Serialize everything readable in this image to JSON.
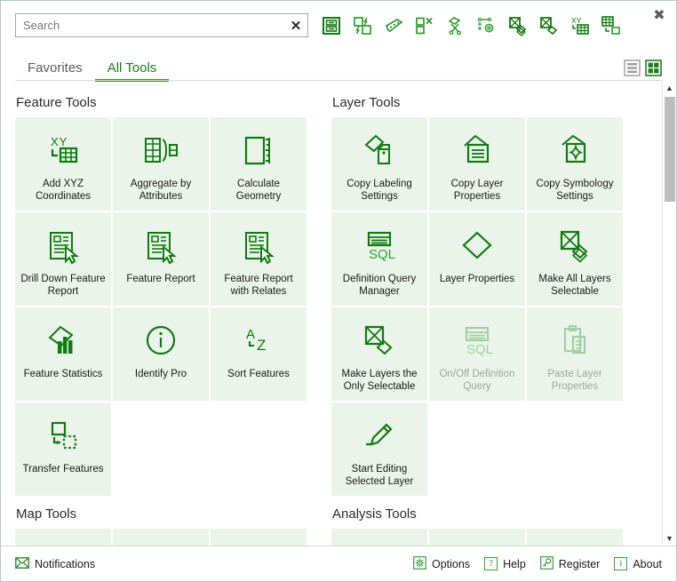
{
  "window": {
    "close_label": "✖"
  },
  "search": {
    "value": "",
    "placeholder": "Search",
    "clear_label": "✕"
  },
  "toolbar": {
    "icons": [
      {
        "name": "batch-attribute-editor-icon",
        "title": "Batch Attribute Editor"
      },
      {
        "name": "flip-fields-icon",
        "title": "Flip Fields"
      },
      {
        "name": "polygon-vertices-icon",
        "title": "Polygon Vertices"
      },
      {
        "name": "delete-feature-icon",
        "title": "Delete Feature"
      },
      {
        "name": "cut-polygons-icon",
        "title": "Cut Polygons"
      },
      {
        "name": "geoprocessing-settings-icon",
        "title": "Geoprocessing Settings"
      },
      {
        "name": "select-layers-stack-icon",
        "title": "Select Layers"
      },
      {
        "name": "select-layer-icon",
        "title": "Select Layer"
      },
      {
        "name": "xy-to-table-icon",
        "title": "XY To Table"
      },
      {
        "name": "table-to-feature-icon",
        "title": "Table To Feature"
      }
    ]
  },
  "tabs": [
    {
      "label": "Favorites",
      "active": false
    },
    {
      "label": "All Tools",
      "active": true
    }
  ],
  "view_toggles": [
    {
      "name": "list-view-toggle",
      "label": "List view",
      "active": false
    },
    {
      "name": "grid-view-toggle",
      "label": "Grid view",
      "active": true
    }
  ],
  "groups": [
    {
      "name": "feature-tools",
      "title": "Feature Tools",
      "column": "left",
      "tiles": [
        {
          "label": "Add XYZ Coordinates",
          "icon": "xy-table-icon",
          "disabled": false
        },
        {
          "label": "Aggregate by Attributes",
          "icon": "aggregate-table-icon",
          "disabled": false
        },
        {
          "label": "Calculate Geometry",
          "icon": "ruler-rectangle-icon",
          "disabled": false
        },
        {
          "label": "Drill Down Feature Report",
          "icon": "report-cursor-icon",
          "disabled": false
        },
        {
          "label": "Feature Report",
          "icon": "report-cursor-icon",
          "disabled": false
        },
        {
          "label": "Feature Report with Relates",
          "icon": "report-cursor-icon",
          "disabled": false
        },
        {
          "label": "Feature Statistics",
          "icon": "polygon-bars-icon",
          "disabled": false
        },
        {
          "label": "Identify Pro",
          "icon": "info-circle-icon",
          "disabled": false
        },
        {
          "label": "Sort Features",
          "icon": "a-to-z-icon",
          "disabled": false
        },
        {
          "label": "Transfer Features",
          "icon": "transfer-square-icon",
          "disabled": false
        }
      ]
    },
    {
      "name": "layer-tools",
      "title": "Layer Tools",
      "column": "right",
      "tiles": [
        {
          "label": "Copy Labeling Settings",
          "icon": "polygon-tag-icon",
          "disabled": false
        },
        {
          "label": "Copy Layer Properties",
          "icon": "polygon-lines-icon",
          "disabled": false
        },
        {
          "label": "Copy Symbology Settings",
          "icon": "polygon-star-icon",
          "disabled": false
        },
        {
          "label": "Definition Query Manager",
          "icon": "sql-table-icon",
          "disabled": false
        },
        {
          "label": "Layer Properties",
          "icon": "diamond-icon",
          "disabled": false
        },
        {
          "label": "Make All Layers Selectable",
          "icon": "layers-select-stack-icon",
          "disabled": false
        },
        {
          "label": "Make Layers the Only Selectable",
          "icon": "layer-select-single-icon",
          "disabled": false
        },
        {
          "label": "On/Off Definition Query",
          "icon": "sql-table-icon",
          "disabled": true
        },
        {
          "label": "Paste Layer Properties",
          "icon": "clipboard-paste-icon",
          "disabled": true
        },
        {
          "label": "Start Editing Selected Layer",
          "icon": "pencil-edit-icon",
          "disabled": false
        }
      ]
    },
    {
      "name": "map-tools",
      "title": "Map Tools",
      "column": "left",
      "tiles": [
        {
          "label": "",
          "icon": "",
          "disabled": false,
          "clipped": true
        },
        {
          "label": "",
          "icon": "",
          "disabled": false,
          "clipped": true
        },
        {
          "label": "",
          "icon": "",
          "disabled": false,
          "clipped": true
        }
      ]
    },
    {
      "name": "analysis-tools",
      "title": "Analysis Tools",
      "column": "right",
      "tiles": [
        {
          "label": "",
          "icon": "",
          "disabled": false,
          "clipped": true
        },
        {
          "label": "",
          "icon": "",
          "disabled": false,
          "clipped": true
        },
        {
          "label": "",
          "icon": "",
          "disabled": false,
          "clipped": true
        }
      ]
    }
  ],
  "scrollbar": {
    "up_label": "▲",
    "down_label": "▼"
  },
  "statusbar": {
    "notifications_label": "Notifications",
    "options_label": "Options",
    "help_label": "Help",
    "register_label": "Register",
    "about_label": "About",
    "help_glyph": "?",
    "about_glyph": "i"
  },
  "colors": {
    "accent_green": "#1f9d1f",
    "icon_green": "#127a12",
    "tile_bg": "#eaf4ea",
    "disabled_text": "#9aa99a"
  }
}
